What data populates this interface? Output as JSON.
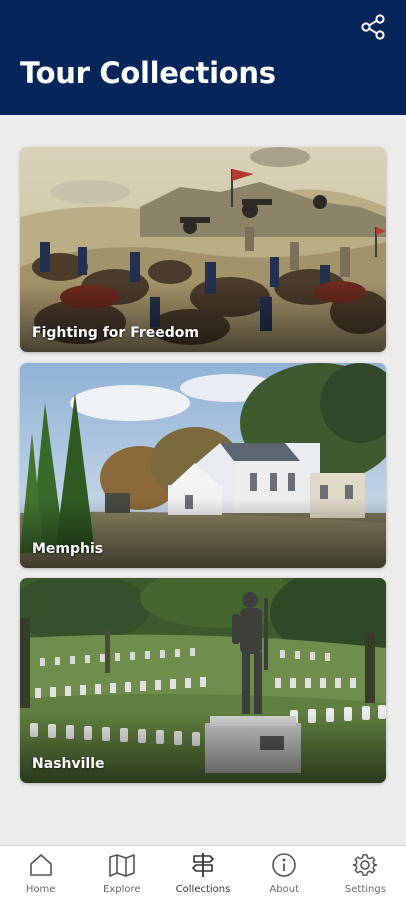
{
  "header": {
    "title": "Tour Collections",
    "share_icon": "share-icon",
    "background_color": "#06255a"
  },
  "collections": [
    {
      "label": "Fighting for Freedom",
      "image": "civil-war-battle-painting"
    },
    {
      "label": "Memphis",
      "image": "white-church-building-with-trees"
    },
    {
      "label": "Nashville",
      "image": "national-cemetery-soldier-statue"
    }
  ],
  "tabbar": {
    "active": "Collections",
    "items": [
      {
        "label": "Home",
        "icon": "home-icon"
      },
      {
        "label": "Explore",
        "icon": "map-icon"
      },
      {
        "label": "Collections",
        "icon": "signpost-icon"
      },
      {
        "label": "About",
        "icon": "info-icon"
      },
      {
        "label": "Settings",
        "icon": "gear-icon"
      }
    ]
  }
}
